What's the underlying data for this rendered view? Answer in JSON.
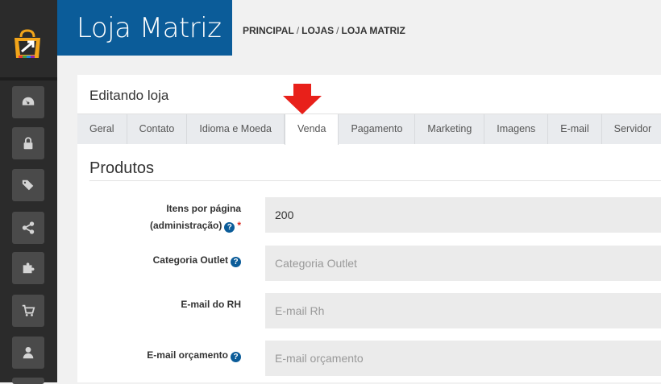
{
  "header": {
    "title": "Loja Matriz",
    "breadcrumb": [
      "PRINCIPAL",
      "LOJAS",
      "LOJA MATRIZ"
    ],
    "breadcrumb_sep": "/"
  },
  "sidebar": {
    "logo": "shopping-bag-logo",
    "items": [
      {
        "icon": "dashboard-icon"
      },
      {
        "icon": "lock-icon"
      },
      {
        "icon": "tags-icon"
      },
      {
        "icon": "share-icon"
      },
      {
        "icon": "puzzle-icon"
      },
      {
        "icon": "cart-icon"
      },
      {
        "icon": "user-icon"
      }
    ]
  },
  "panel": {
    "title": "Editando loja",
    "tabs": [
      "Geral",
      "Contato",
      "Idioma e Moeda",
      "Venda",
      "Pagamento",
      "Marketing",
      "Imagens",
      "E-mail",
      "Servidor"
    ],
    "active_tab": "Venda",
    "section_title": "Produtos"
  },
  "form": {
    "items_per_page": {
      "label_line1": "Itens por página",
      "label_line2": "(administração)",
      "value": "200",
      "required_mark": "*"
    },
    "outlet_category": {
      "label": "Categoria Outlet",
      "placeholder": "Categoria Outlet"
    },
    "hr_email": {
      "label": "E-mail do RH",
      "placeholder": "E-mail Rh"
    },
    "budget_email": {
      "label": "E-mail orçamento",
      "placeholder": "E-mail orçamento"
    }
  },
  "colors": {
    "brand": "#0b5c99",
    "sidebar": "#2b2b2b",
    "arrow": "#e8201a",
    "required": "#d9261c"
  }
}
